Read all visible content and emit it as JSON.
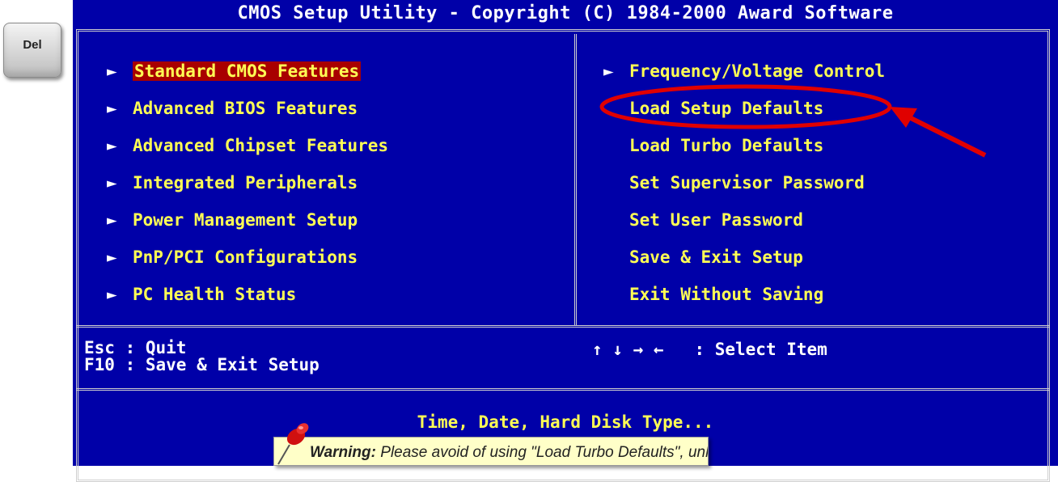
{
  "keycap": {
    "label": "Del"
  },
  "bios": {
    "title": "CMOS Setup Utility - Copyright (C) 1984-2000 Award Software",
    "left_menu": [
      {
        "label": "Standard CMOS Features",
        "arrow": "►",
        "selected": true
      },
      {
        "label": "Advanced BIOS Features",
        "arrow": "►"
      },
      {
        "label": "Advanced Chipset Features",
        "arrow": "►"
      },
      {
        "label": "Integrated Peripherals",
        "arrow": "►"
      },
      {
        "label": "Power Management Setup",
        "arrow": "►"
      },
      {
        "label": "PnP/PCI Configurations",
        "arrow": "►"
      },
      {
        "label": "PC Health Status",
        "arrow": "►"
      }
    ],
    "right_menu": [
      {
        "label": "Frequency/Voltage Control",
        "arrow": "►"
      },
      {
        "label": "Load Setup Defaults"
      },
      {
        "label": "Load Turbo Defaults"
      },
      {
        "label": "Set Supervisor Password"
      },
      {
        "label": "Set User Password"
      },
      {
        "label": "Save & Exit Setup"
      },
      {
        "label": "Exit Without Saving"
      }
    ],
    "help_esc": "Esc : Quit",
    "help_f10": "F10 : Save & Exit Setup",
    "nav_keys": "↑ ↓ → ←",
    "nav_label": ": Select Item",
    "description": "Time, Date, Hard Disk Type..."
  },
  "warning": {
    "label": "Warning:",
    "text": "Please avoid of using \"Load Turbo Defaults\", unless"
  },
  "colors": {
    "bios_bg": "#0000a8",
    "menu_text": "#ffff54",
    "highlight": "#a80000",
    "annotation": "#e00000",
    "note_bg": "#ffffc8"
  },
  "icons": [
    "keycap-icon",
    "menu-arrow-icon",
    "pushpin-icon",
    "red-circle-annotation",
    "red-arrow-annotation"
  ]
}
